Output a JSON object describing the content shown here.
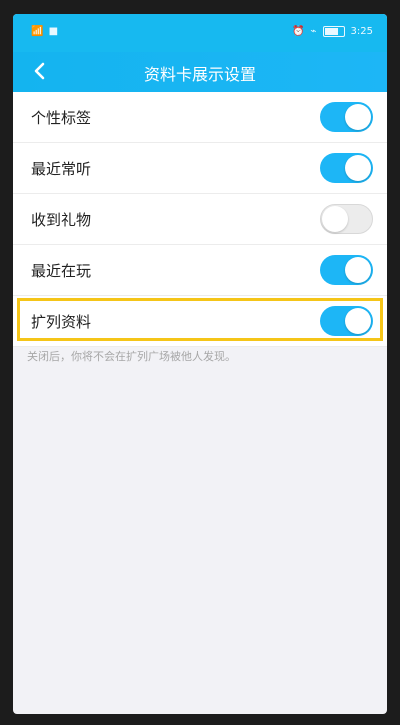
{
  "status_bar": {
    "left_text": "📶 ■",
    "time": "3:25"
  },
  "nav": {
    "title": "资料卡展示设置",
    "back_icon": "chevron-left-icon"
  },
  "settings": [
    {
      "label": "个性标签",
      "on": true
    },
    {
      "label": "最近常听",
      "on": true
    },
    {
      "label": "收到礼物",
      "on": false
    },
    {
      "label": "最近在玩",
      "on": true
    },
    {
      "label": "扩列资料",
      "on": true
    }
  ],
  "hint": "关闭后，你将不会在扩列广场被他人发现。",
  "colors": {
    "accent": "#1db6f6",
    "highlight": "#f5c518"
  }
}
